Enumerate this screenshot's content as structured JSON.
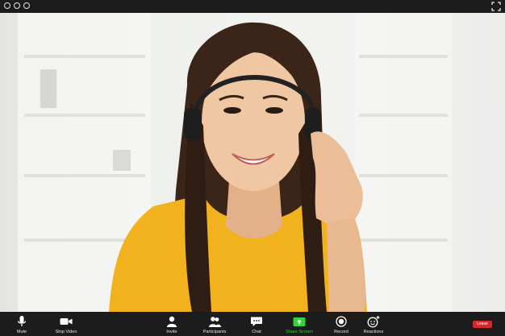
{
  "window": {
    "controls": [
      "circle-icon",
      "circle-icon",
      "circle-icon"
    ],
    "fullscreen_icon": "expand-icon"
  },
  "video": {
    "subject": "participant-video-feed"
  },
  "toolbar": {
    "mute_label": "Mute",
    "stop_video_label": "Stop Video",
    "invite_label": "Invite",
    "participants_label": "Participants",
    "chat_label": "Chat",
    "share_screen_label": "Share Screen",
    "record_label": "Record",
    "reactions_label": "Reactions",
    "leave_label": "Leave"
  },
  "colors": {
    "bar_background": "#1c1c1c",
    "share_accent": "#2fd33b",
    "leave_red": "#d6262e",
    "shirt_yellow": "#f2b21e"
  }
}
